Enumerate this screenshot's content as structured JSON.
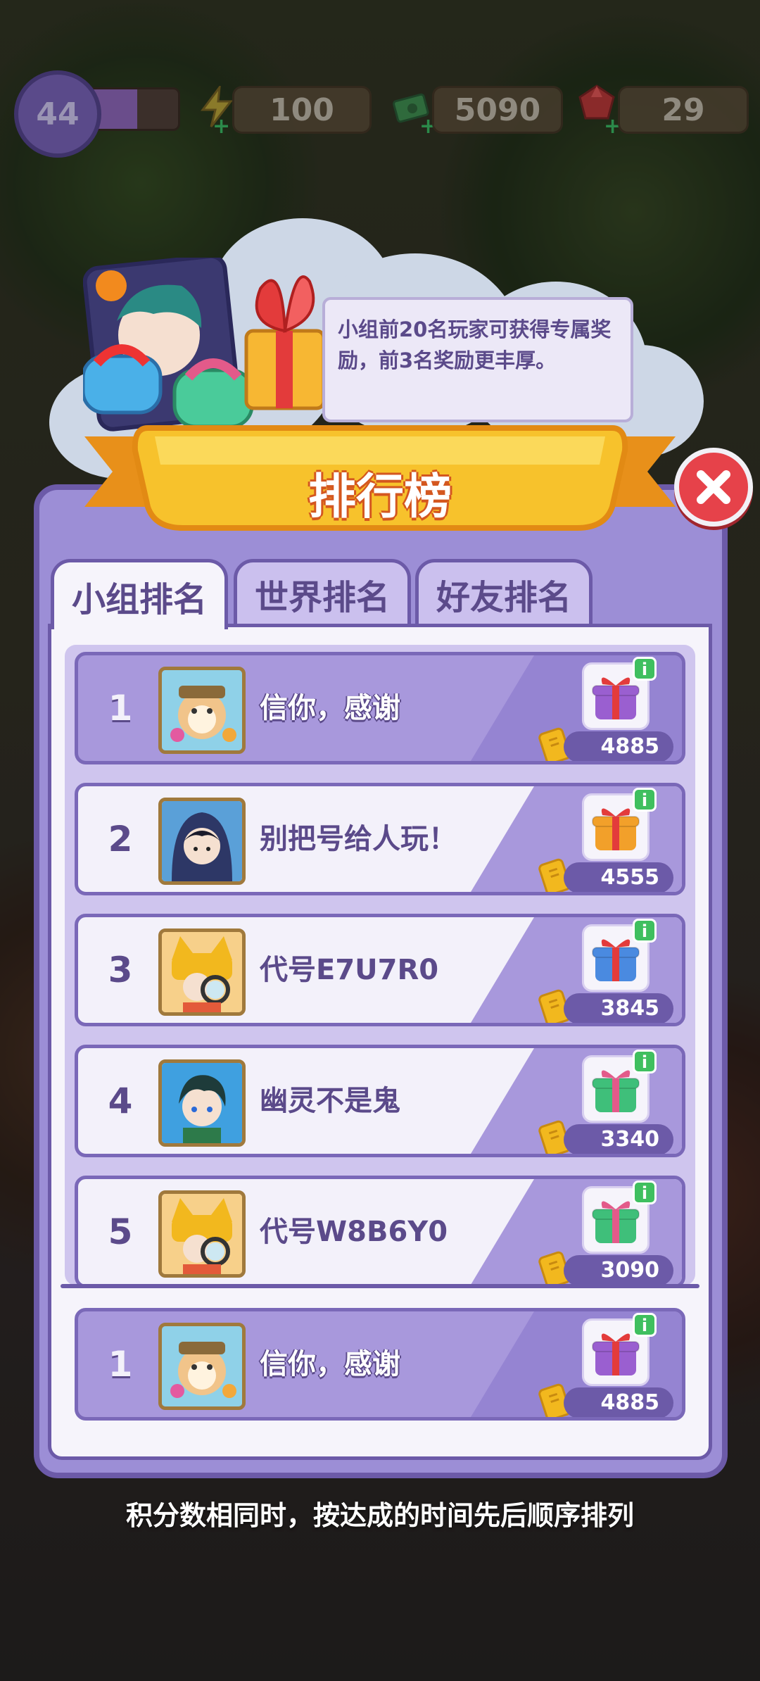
{
  "status_bar": {
    "level": "44",
    "level_progress": 0.55,
    "energy": "100",
    "cash": "5090",
    "gems": "29"
  },
  "tip_text": "小组前20名玩家可获得专属奖励，前3名奖励更丰厚。",
  "panel_title": "排行榜",
  "tabs": [
    {
      "label": "小组排名",
      "active": true
    },
    {
      "label": "世界排名",
      "active": false
    },
    {
      "label": "好友排名",
      "active": false
    }
  ],
  "rows": [
    {
      "rank": "1",
      "name": "信你，感谢",
      "score": "4885",
      "me": true,
      "gift": "purple-gift",
      "avatar": "hamster-avatar"
    },
    {
      "rank": "2",
      "name": "别把号给人玩！",
      "score": "4555",
      "me": false,
      "gift": "orange-gift",
      "avatar": "hooded-boy-avatar"
    },
    {
      "rank": "3",
      "name": "代号E7U7R0",
      "score": "3845",
      "me": false,
      "gift": "blue-gift",
      "avatar": "detective-cat-avatar"
    },
    {
      "rank": "4",
      "name": "幽灵不是鬼",
      "score": "3340",
      "me": false,
      "gift": "green-gift",
      "avatar": "green-hair-boy-avatar"
    },
    {
      "rank": "5",
      "name": "代号W8B6Y0",
      "score": "3090",
      "me": false,
      "gift": "green-gift",
      "avatar": "detective-cat-avatar"
    }
  ],
  "my_row": {
    "rank": "1",
    "name": "信你，感谢",
    "score": "4885",
    "gift": "purple-gift",
    "avatar": "hamster-avatar"
  },
  "footer_note": "积分数相同时，按达成的时间先后顺序排列",
  "colors": {
    "panel": "#9c8ed6",
    "border": "#6c5aa8",
    "accent": "#f5b024",
    "close": "#e6424a"
  }
}
